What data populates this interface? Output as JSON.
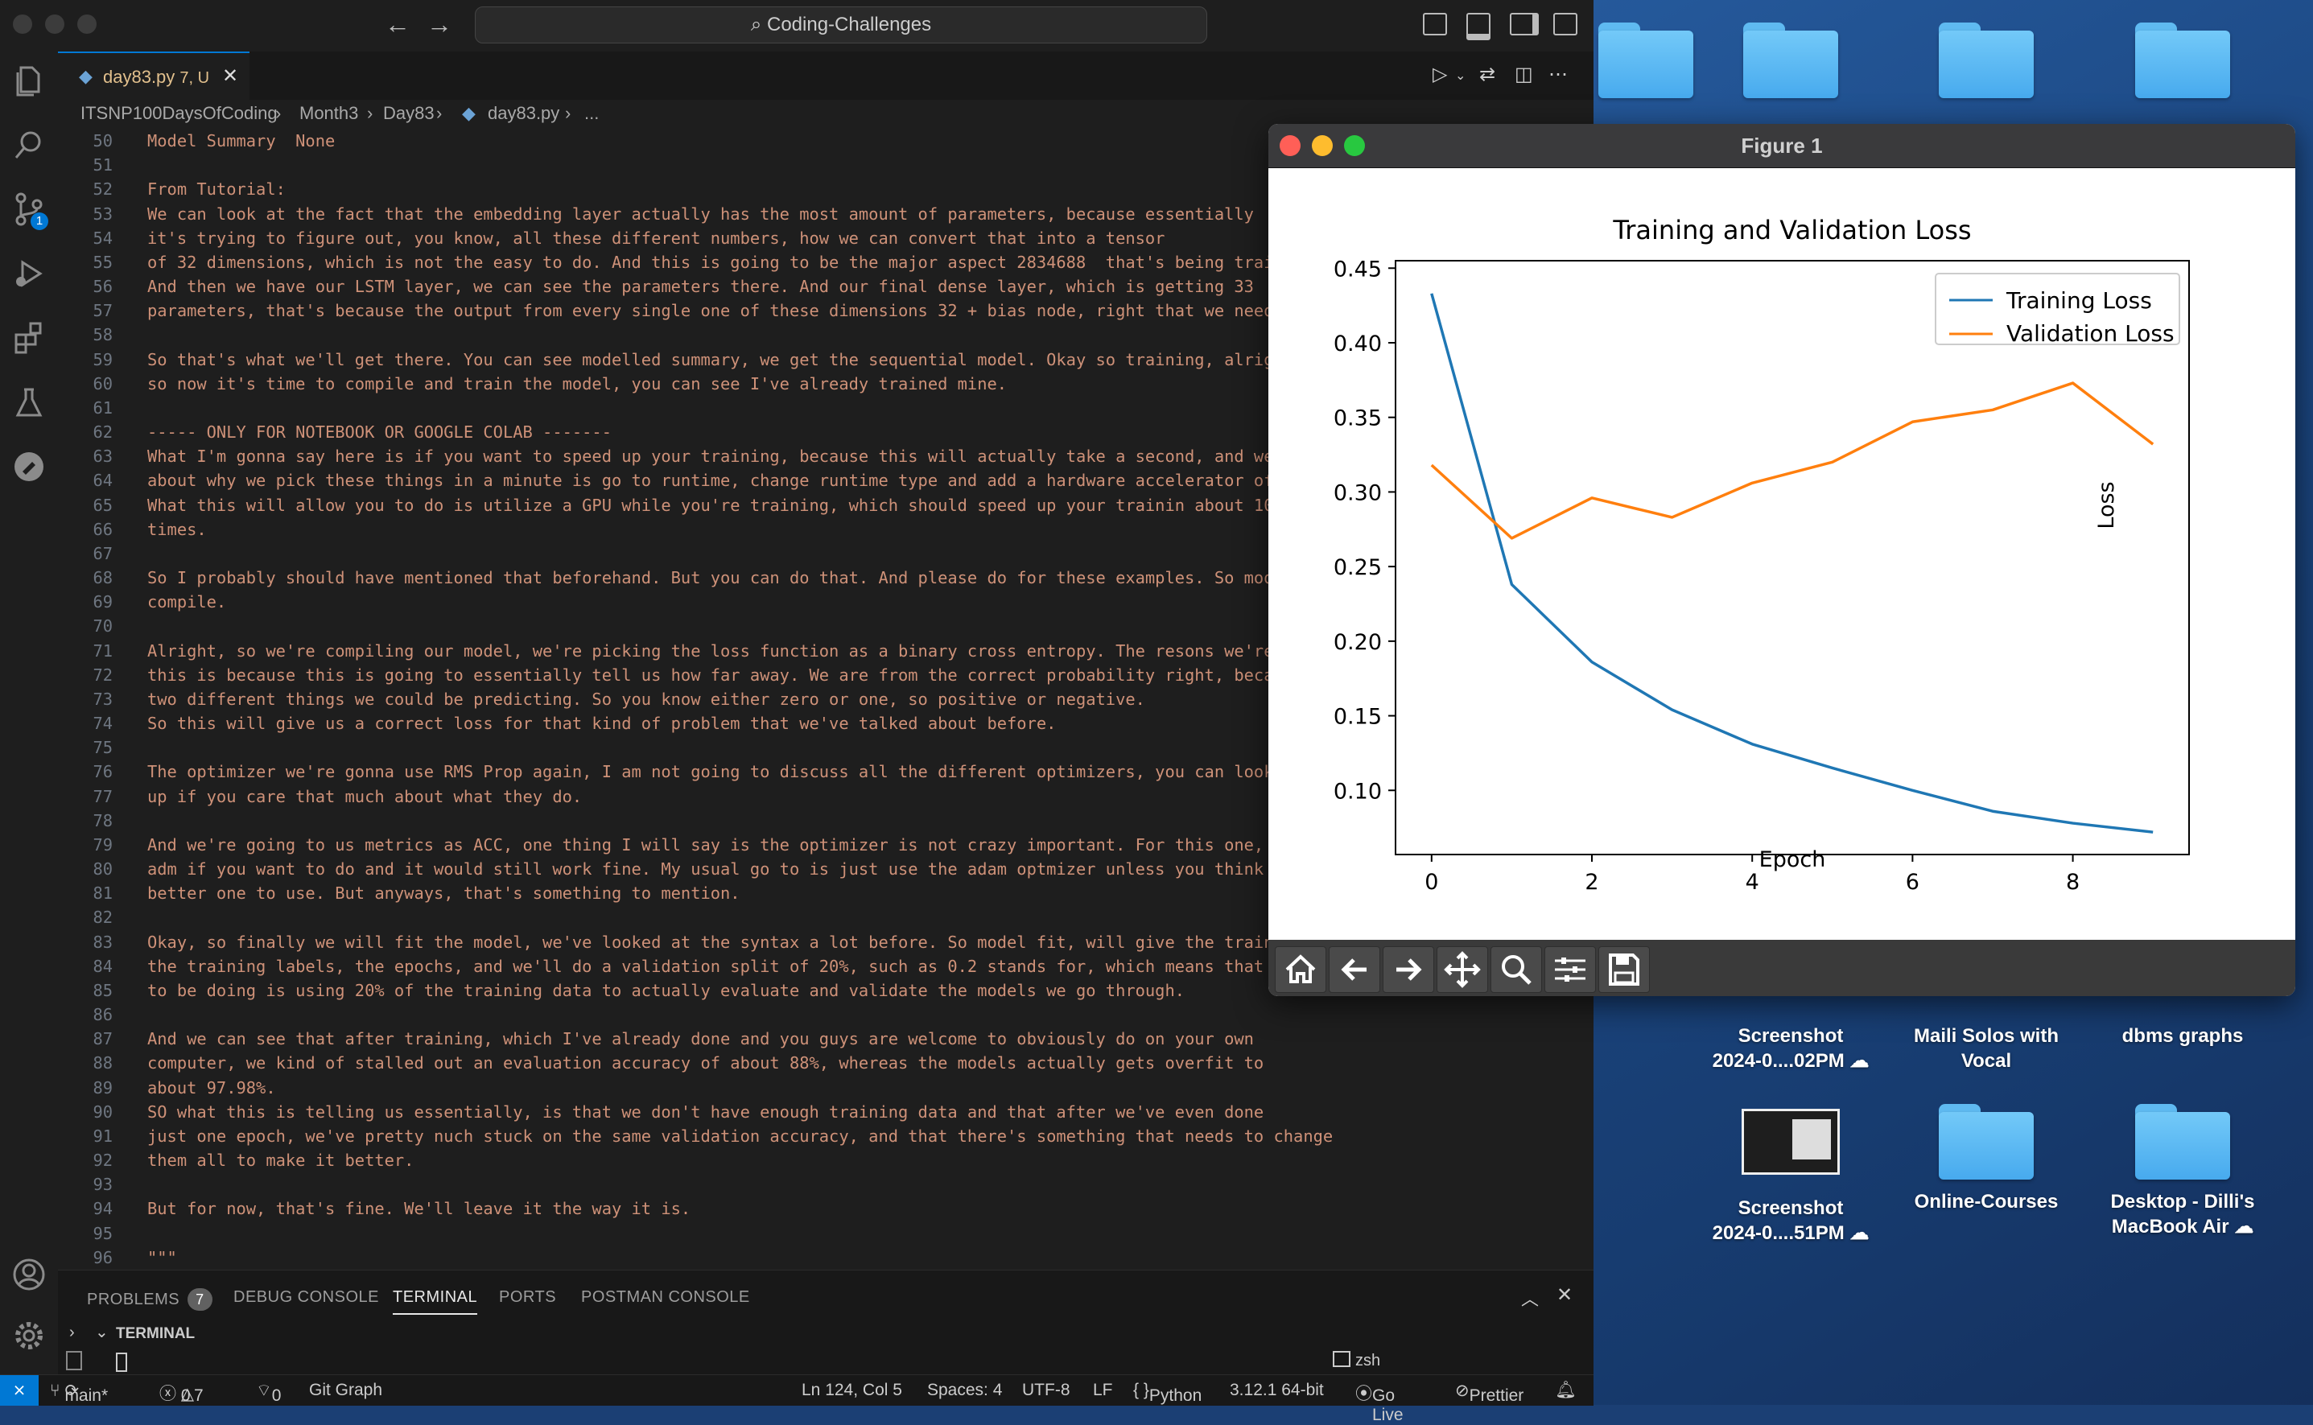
{
  "window": {
    "command_center": "Coding-Challenges"
  },
  "activity_bar": {
    "source_control_badge": "1"
  },
  "tab": {
    "filename": "day83.py",
    "status": "7, U"
  },
  "breadcrumb": [
    "ITSNP100DaysOfCoding",
    "Month3",
    "Day83",
    "day83.py",
    "..."
  ],
  "editor": {
    "lines": [
      {
        "n": "50",
        "t": "Model Summary  None"
      },
      {
        "n": "51",
        "t": ""
      },
      {
        "n": "52",
        "t": "From Tutorial:"
      },
      {
        "n": "53",
        "t": "We can look at the fact that the embedding layer actually has the most amount of parameters, because essentially"
      },
      {
        "n": "54",
        "t": "it's trying to figure out, you know, all these different numbers, how we can convert that into a tensor"
      },
      {
        "n": "55",
        "t": "of 32 dimensions, which is not the easy to do. And this is going to be the major aspect 2834688  that's being trained."
      },
      {
        "n": "56",
        "t": "And then we have our LSTM layer, we can see the parameters there. And our final dense layer, which is getting 33"
      },
      {
        "n": "57",
        "t": "parameters, that's because the output from every single one of these dimensions 32 + bias node, right that we need."
      },
      {
        "n": "58",
        "t": ""
      },
      {
        "n": "59",
        "t": "So that's what we'll get there. You can see modelled summary, we get the sequential model. Okay so training, alright"
      },
      {
        "n": "60",
        "t": "so now it's time to compile and train the model, you can see I've already trained mine."
      },
      {
        "n": "61",
        "t": ""
      },
      {
        "n": "62",
        "t": "----- ONLY FOR NOTEBOOK OR GOOGLE COLAB -------"
      },
      {
        "n": "63",
        "t": "What I'm gonna say here is if you want to speed up your training, because this will actually take a second, and we'll talk"
      },
      {
        "n": "64",
        "t": "about why we pick these things in a minute is go to runtime, change runtime type and add a hardware accelerator of GPU."
      },
      {
        "n": "65",
        "t": "What this will allow you to do is utilize a GPU while you're training, which should speed up your trainin about 10 x"
      },
      {
        "n": "66",
        "t": "times."
      },
      {
        "n": "67",
        "t": ""
      },
      {
        "n": "68",
        "t": "So I probably should have mentioned that beforehand. But you can do that. And please do for these examples. So model"
      },
      {
        "n": "69",
        "t": "compile."
      },
      {
        "n": "70",
        "t": ""
      },
      {
        "n": "71",
        "t": "Alright, so we're compiling our model, we're picking the loss function as a binary cross entropy. The resons we're picking"
      },
      {
        "n": "72",
        "t": "this is because this is going to essentially tell us how far away. We are from the correct probability right, because"
      },
      {
        "n": "73",
        "t": "two different things we could be predicting. So you know either zero or one, so positive or negative."
      },
      {
        "n": "74",
        "t": "So this will give us a correct loss for that kind of problem that we've talked about before."
      },
      {
        "n": "75",
        "t": ""
      },
      {
        "n": "76",
        "t": "The optimizer we're gonna use RMS Prop again, I am not going to discuss all the different optimizers, you can look them"
      },
      {
        "n": "77",
        "t": "up if you care that much about what they do."
      },
      {
        "n": "78",
        "t": ""
      },
      {
        "n": "79",
        "t": "And we're going to us metrics as ACC, one thing I will say is the optimizer is not crazy important. For this one, you could use"
      },
      {
        "n": "80",
        "t": "adm if you want to do and it would still work fine. My usual go to is just use the adam optmizer unless you think there's a"
      },
      {
        "n": "81",
        "t": "better one to use. But anyways, that's something to mention."
      },
      {
        "n": "82",
        "t": ""
      },
      {
        "n": "83",
        "t": "Okay, so finally we will fit the model, we've looked at the syntax a lot before. So model fit, will give the training data,"
      },
      {
        "n": "84",
        "t": "the training labels, the epochs, and we'll do a validation split of 20%, such as 0.2 stands for, which means that what we're going"
      },
      {
        "n": "85",
        "t": "to be doing is using 20% of the training data to actually evaluate and validate the models we go through."
      },
      {
        "n": "86",
        "t": ""
      },
      {
        "n": "87",
        "t": "And we can see that after training, which I've already done and you guys are welcome to obviously do on your own"
      },
      {
        "n": "88",
        "t": "computer, we kind of stalled out an evaluation accuracy of about 88%, whereas the models actually gets overfit to"
      },
      {
        "n": "89",
        "t": "about 97.98%."
      },
      {
        "n": "90",
        "t": "SO what this is telling us essentially, is that we don't have enough training data and that after we've even done"
      },
      {
        "n": "91",
        "t": "just one epoch, we've pretty nuch stuck on the same validation accuracy, and that there's something that needs to change"
      },
      {
        "n": "92",
        "t": "them all to make it better."
      },
      {
        "n": "93",
        "t": ""
      },
      {
        "n": "94",
        "t": "But for now, that's fine. We'll leave it the way it is."
      },
      {
        "n": "95",
        "t": ""
      },
      {
        "n": "96",
        "t": "\"\"\""
      }
    ]
  },
  "panel": {
    "tabs": [
      "PROBLEMS",
      "DEBUG CONSOLE",
      "TERMINAL",
      "PORTS",
      "POSTMAN CONSOLE"
    ],
    "problems_count": "7",
    "section_title": "TERMINAL",
    "shell": "zsh"
  },
  "statusbar": {
    "branch": "main*",
    "errors": "0",
    "warnings": "7",
    "ports": "0",
    "git_graph": "Git Graph",
    "position": "Ln 124, Col 5",
    "spaces": "Spaces: 4",
    "encoding": "UTF-8",
    "eol": "LF",
    "language": "Python",
    "interpreter": "3.12.1 64-bit",
    "go_live": "Go Live",
    "prettier": "Prettier"
  },
  "figure": {
    "window_title": "Figure 1"
  },
  "chart_data": {
    "type": "line",
    "title": "Training and Validation Loss",
    "xlabel": "Epoch",
    "ylabel": "Loss",
    "x": [
      0,
      1,
      2,
      3,
      4,
      5,
      6,
      7,
      8,
      9
    ],
    "xticks": [
      "0",
      "2",
      "4",
      "6",
      "8"
    ],
    "yticks": [
      "0.10",
      "0.15",
      "0.20",
      "0.25",
      "0.30",
      "0.35",
      "0.40",
      "0.45"
    ],
    "xlim": [
      -0.45,
      9.45
    ],
    "ylim": [
      0.057,
      0.455
    ],
    "legend": "upper right",
    "series": [
      {
        "name": "Training Loss",
        "color": "#1f77b4",
        "values": [
          0.433,
          0.238,
          0.186,
          0.154,
          0.131,
          0.115,
          0.1,
          0.086,
          0.078,
          0.072
        ]
      },
      {
        "name": "Validation Loss",
        "color": "#ff7f0e",
        "values": [
          0.318,
          0.269,
          0.296,
          0.283,
          0.306,
          0.32,
          0.347,
          0.355,
          0.373,
          0.332
        ]
      }
    ]
  },
  "desktop": {
    "items": [
      {
        "label1": "Screenshot",
        "label2": "2024-0....02PM ☁"
      },
      {
        "label1": "Maili Solos with",
        "label2": "Vocal"
      },
      {
        "label1": "dbms graphs",
        "label2": ""
      },
      {
        "label1": "Screenshot",
        "label2": "2024-0....51PM ☁"
      },
      {
        "label1": "Online-Courses",
        "label2": ""
      },
      {
        "label1": "Desktop - Dilli's",
        "label2": "MacBook Air ☁"
      }
    ]
  }
}
